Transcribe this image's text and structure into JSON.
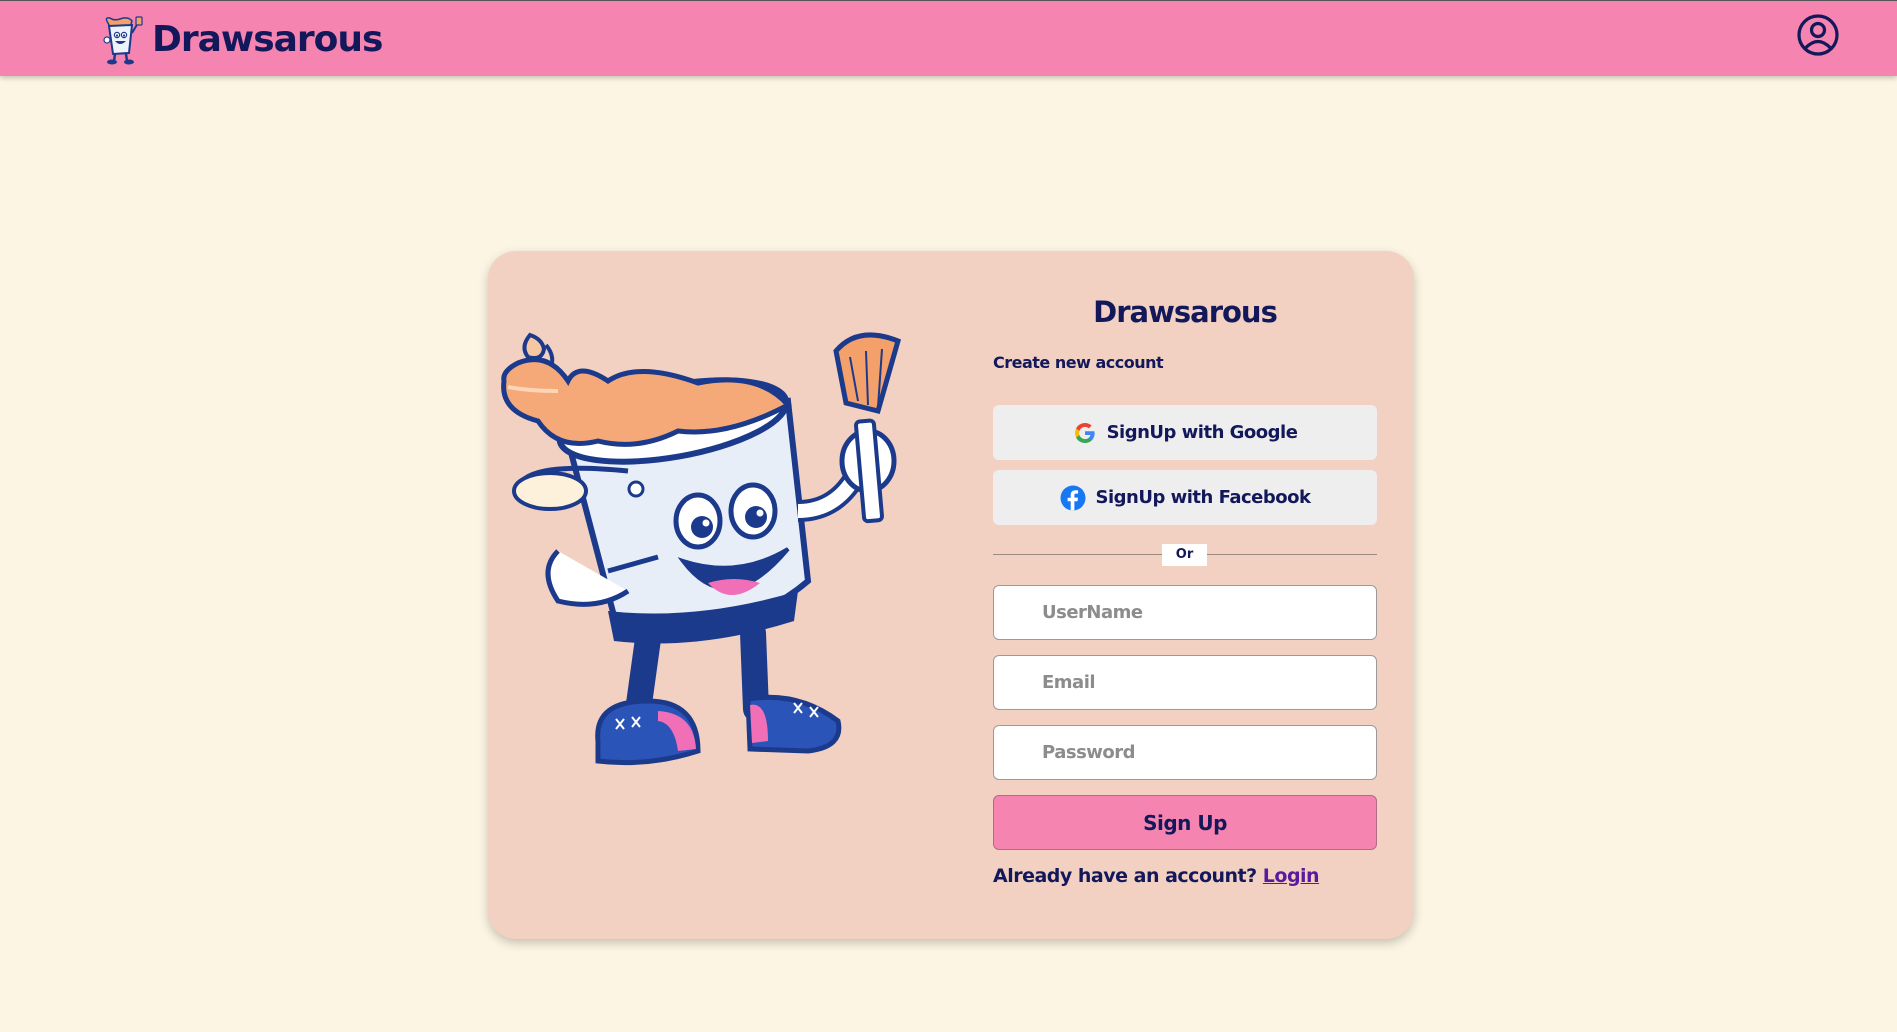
{
  "header": {
    "brand_name": "Drawsarous",
    "logo_icon": "paint-bucket-mascot-icon",
    "profile_icon": "user-circle-icon",
    "colors": {
      "bar": "#f584b0",
      "text": "#12185a"
    }
  },
  "page": {
    "background": "#fdf5e3"
  },
  "card": {
    "background": "#f2d1c2",
    "illustration": "paint-bucket-mascot-with-brush"
  },
  "form": {
    "title": "Drawsarous",
    "subtitle": "Create new account",
    "google_label": "SignUp with Google",
    "google_icon": "google-icon",
    "facebook_label": "SignUp with Facebook",
    "facebook_icon": "facebook-icon",
    "divider_label": "Or",
    "username_placeholder": "UserName",
    "email_placeholder": "Email",
    "password_placeholder": "Password",
    "submit_label": "Sign Up",
    "login_prompt": "Already have an account?",
    "login_link": "Login"
  }
}
